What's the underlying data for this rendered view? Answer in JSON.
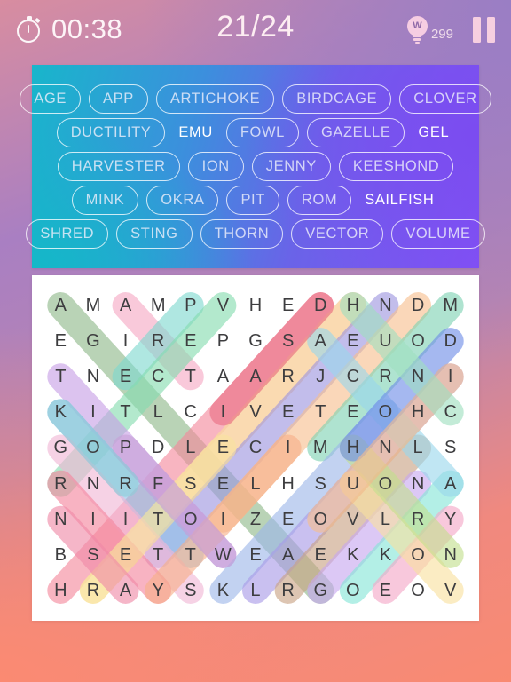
{
  "topbar": {
    "timer": "00:38",
    "progress": "21/24",
    "hint_count": "299",
    "hint_letter": "W",
    "icons": {
      "stopwatch": "stopwatch-icon",
      "bulb": "lightbulb-hint-icon",
      "pause": "pause-icon"
    }
  },
  "word_panel": {
    "rows": [
      [
        {
          "text": "AGE",
          "found": true
        },
        {
          "text": "APP",
          "found": true
        },
        {
          "text": "ARTICHOKE",
          "found": true
        },
        {
          "text": "BIRDCAGE",
          "found": true
        },
        {
          "text": "CLOVER",
          "found": true
        }
      ],
      [
        {
          "text": "DUCTILITY",
          "found": true
        },
        {
          "text": "EMU",
          "found": false
        },
        {
          "text": "FOWL",
          "found": true
        },
        {
          "text": "GAZELLE",
          "found": true
        },
        {
          "text": "GEL",
          "found": false
        }
      ],
      [
        {
          "text": "HARVESTER",
          "found": true
        },
        {
          "text": "ION",
          "found": true
        },
        {
          "text": "JENNY",
          "found": true
        },
        {
          "text": "KEESHOND",
          "found": true
        }
      ],
      [
        {
          "text": "MINK",
          "found": true
        },
        {
          "text": "OKRA",
          "found": true
        },
        {
          "text": "PIT",
          "found": true
        },
        {
          "text": "ROM",
          "found": true
        },
        {
          "text": "SAILFISH",
          "found": false
        }
      ],
      [
        {
          "text": "SHRED",
          "found": true
        },
        {
          "text": "STING",
          "found": true
        },
        {
          "text": "THORN",
          "found": true
        },
        {
          "text": "VECTOR",
          "found": true
        },
        {
          "text": "VOLUME",
          "found": true
        }
      ]
    ]
  },
  "grid": {
    "columns": 13,
    "rows": 9,
    "letters": [
      [
        "A",
        "M",
        "A",
        "M",
        "P",
        "V",
        "H",
        "E",
        "D",
        "H",
        "N",
        "D",
        "M"
      ],
      [
        "E",
        "G",
        "I",
        "R",
        "E",
        "P",
        "G",
        "S",
        "A",
        "E",
        "U",
        "O",
        "D"
      ],
      [
        "T",
        "N",
        "E",
        "C",
        "T",
        "A",
        "A",
        "R",
        "J",
        "C",
        "R",
        "N",
        "I"
      ],
      [
        "K",
        "I",
        "T",
        "L",
        "C",
        "I",
        "V",
        "E",
        "T",
        "E",
        "O",
        "H",
        "C"
      ],
      [
        "G",
        "O",
        "P",
        "D",
        "L",
        "E",
        "C",
        "I",
        "M",
        "H",
        "N",
        "L",
        "S"
      ],
      [
        "R",
        "N",
        "R",
        "F",
        "S",
        "E",
        "L",
        "H",
        "S",
        "U",
        "O",
        "N",
        "A"
      ],
      [
        "N",
        "I",
        "I",
        "T",
        "O",
        "I",
        "Z",
        "E",
        "O",
        "V",
        "L",
        "R",
        "Y"
      ],
      [
        "B",
        "S",
        "E",
        "T",
        "T",
        "W",
        "E",
        "A",
        "E",
        "K",
        "K",
        "O",
        "N"
      ],
      [
        "H",
        "R",
        "A",
        "Y",
        "S",
        "K",
        "L",
        "R",
        "G",
        "O",
        "E",
        "O",
        "V"
      ]
    ],
    "highlights": [
      {
        "word": "ARTICHOKE",
        "color": "#8fb98a",
        "r1": 0,
        "c1": 0,
        "r2": 8,
        "c2": 8
      },
      {
        "word": "APP",
        "color": "#f6a9c4",
        "r1": 0,
        "c1": 2,
        "r2": 2,
        "c2": 4
      },
      {
        "word": "AGE",
        "color": "#7fd9cf",
        "r1": 0,
        "c1": 4,
        "r2": 2,
        "c2": 2
      },
      {
        "word": "VECTOR",
        "color": "#85dcb0",
        "r1": 0,
        "c1": 5,
        "r2": 5,
        "c2": 0
      },
      {
        "word": "DUCTILITY",
        "color": "#f5889c",
        "r1": 0,
        "c1": 8,
        "r2": 8,
        "c2": 0
      },
      {
        "word": "BIRDCAGE",
        "color": "#f7a8c0",
        "r1": 0,
        "c1": 9,
        "r2": 7,
        "c2": 2
      },
      {
        "word": "HARVESTER",
        "color": "#fbe59a",
        "r1": 0,
        "c1": 9,
        "r2": 8,
        "c2": 1
      },
      {
        "word": "KEESHOND",
        "color": "#9d96e0",
        "r1": 0,
        "c1": 10,
        "r2": 7,
        "c2": 3
      },
      {
        "word": "CLOVER",
        "color": "#f7c08f",
        "r1": 0,
        "c1": 11,
        "r2": 6,
        "c2": 5
      },
      {
        "word": "MINK",
        "color": "#7fd3b4",
        "r1": 0,
        "c1": 12,
        "r2": 4,
        "c2": 8
      },
      {
        "word": "THORN",
        "color": "#c79fe6",
        "r1": 2,
        "c1": 0,
        "r2": 7,
        "c2": 5
      },
      {
        "word": "OKRA",
        "color": "#8fc1e8",
        "r1": 3,
        "c1": 0,
        "r2": 7,
        "c2": 4
      },
      {
        "word": "ION",
        "color": "#f2b7d6",
        "r1": 4,
        "c1": 0,
        "r2": 8,
        "c2": 4
      },
      {
        "word": "PIT",
        "color": "#f5869d",
        "r1": 5,
        "c1": 0,
        "r2": 8,
        "c2": 3
      },
      {
        "word": "SHRED",
        "color": "#f9e3a0",
        "r1": 8,
        "c1": 1,
        "r2": 4,
        "c2": 5
      },
      {
        "word": "STING",
        "color": "#f7b089",
        "r1": 8,
        "c1": 3,
        "r2": 4,
        "c2": 7
      },
      {
        "word": "VOLUME",
        "color": "#9db7ea",
        "r1": 8,
        "c1": 5,
        "r2": 3,
        "c2": 10
      },
      {
        "word": "GAZELLE",
        "color": "#a99ae8",
        "r1": 8,
        "c1": 6,
        "r2": 2,
        "c2": 12
      },
      {
        "word": "JENNY",
        "color": "#c9a384",
        "r1": 8,
        "c1": 7,
        "r2": 4,
        "c2": 11
      },
      {
        "word": "ROM",
        "color": "#c7a7f0",
        "r1": 8,
        "c1": 8,
        "r2": 5,
        "c2": 11
      },
      {
        "word": "APP2",
        "color": "#86e6d8",
        "r1": 8,
        "c1": 9,
        "r2": 5,
        "c2": 12
      },
      {
        "word": "AGE2",
        "color": "#f5a8c8",
        "r1": 8,
        "c1": 10,
        "r2": 6,
        "c2": 12
      },
      {
        "word": "OKRA2",
        "color": "#f9e1a0",
        "r1": 8,
        "c1": 12,
        "r2": 5,
        "c2": 9
      },
      {
        "word": "CLOVER2",
        "color": "#c3e08e",
        "r1": 7,
        "c1": 12,
        "r2": 4,
        "c2": 9
      },
      {
        "word": "MINK2",
        "color": "#9ad7ec",
        "r1": 5,
        "c1": 12,
        "r2": 1,
        "c2": 8
      },
      {
        "word": "BIRD2",
        "color": "#6f8de8",
        "r1": 1,
        "c1": 12,
        "r2": 4,
        "c2": 9
      },
      {
        "word": "EXTRA1",
        "color": "#f7bf8d",
        "r1": 2,
        "c1": 12,
        "r2": 6,
        "c2": 8
      },
      {
        "word": "EXTRA2",
        "color": "#a0e0c0",
        "r1": 3,
        "c1": 12,
        "r2": 0,
        "c2": 9
      },
      {
        "word": "EXTRA3",
        "color": "#ea6f84",
        "r1": 0,
        "c1": 8,
        "r2": 3,
        "c2": 5
      },
      {
        "word": "EXTRA4",
        "color": "#c8a0d8",
        "r1": 4,
        "c1": 2,
        "r2": 7,
        "c2": 5
      },
      {
        "word": "EXTRA5",
        "color": "#f08aa8",
        "r1": 6,
        "c1": 0,
        "r2": 8,
        "c2": 2
      },
      {
        "word": "EXTRA6",
        "color": "#8ecdd8",
        "r1": 3,
        "c1": 0,
        "r2": 5,
        "c2": 2
      }
    ]
  },
  "colors": {
    "accent_purple": "#8250f5",
    "accent_teal": "#18b6cb",
    "bg_coral": "#f98a72",
    "bg_violet": "#a97fc2",
    "panel_white": "#ffffff",
    "letter": "#3d3d3f"
  }
}
